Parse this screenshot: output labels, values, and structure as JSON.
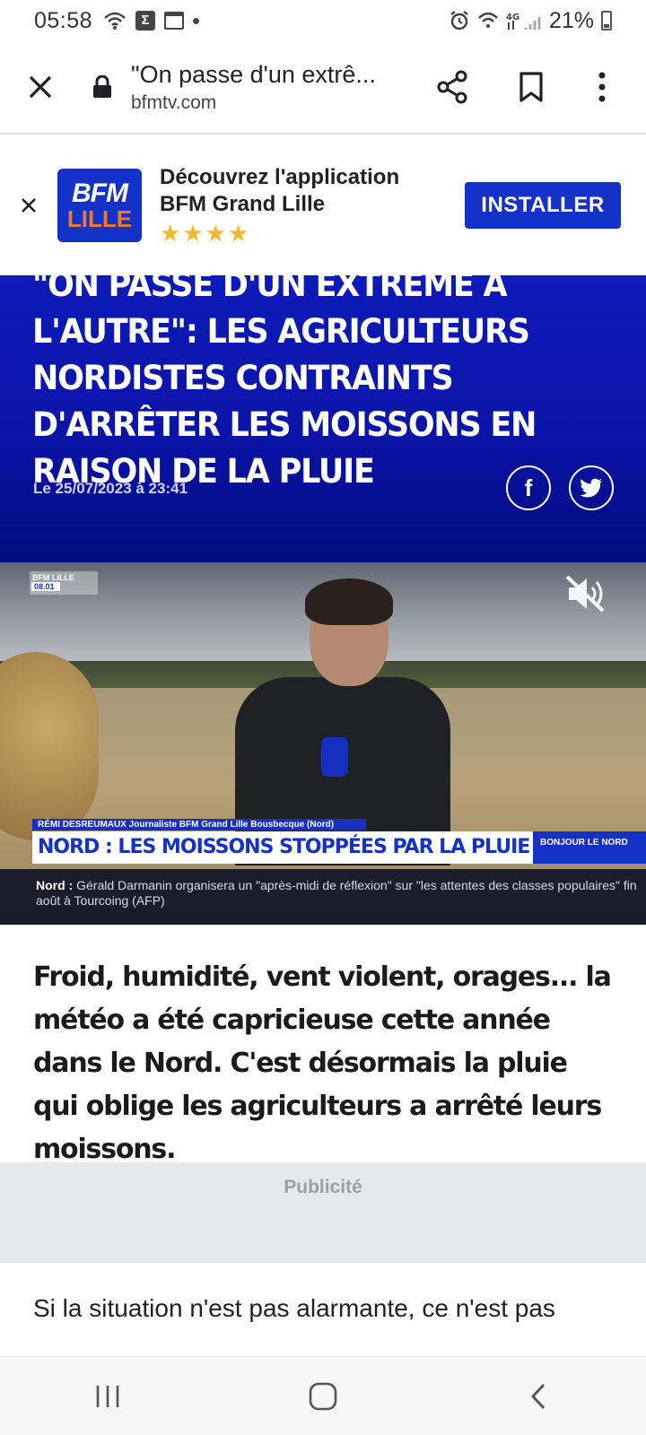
{
  "status_bar": {
    "time": "05:58",
    "battery": "21%",
    "icons": [
      "wifi-icon",
      "sigma-icon",
      "calendar-icon",
      "dot-icon",
      "alarm-icon",
      "wifi-4g-icon",
      "signal-icon",
      "battery-icon"
    ]
  },
  "toolbar": {
    "page_title": "\"On passe d'un extrê...",
    "domain": "bfmtv.com",
    "icons": [
      "close-icon",
      "lock-icon",
      "share-icon",
      "bookmark-icon",
      "more-vert-icon"
    ]
  },
  "app_banner": {
    "logo_top": "BFM",
    "logo_bottom": "LILLE",
    "line1": "Découvrez l'application",
    "line2": "BFM Grand Lille",
    "stars": "★★★★",
    "install_label": "INSTALLER",
    "accent": "#1432c8"
  },
  "article": {
    "title": "\"On passe d'un extrême à l'autre\": les agriculteurs nordistes contraints d'arrêter les moissons en raison de la pluie",
    "date": "Le 25/07/2023 à 23:41",
    "share": {
      "facebook": "f"
    },
    "lead": "Froid, humidité, vent violent, orages... la météo a été capricieuse cette année dans le Nord. C'est désormais la pluie qui oblige les agriculteurs a arrêté leurs moissons.",
    "body_first_line": "Si la situation n'est pas alarmante, ce n'est pas"
  },
  "video": {
    "bug_top": "BFM LILLE",
    "bug_time": "08.01",
    "name_bar": "RÉMI DESREUMAUX  Journaliste BFM Grand Lille  Bousbecque (Nord)",
    "headline": "NORD : LES MOISSONS STOPPÉES PAR LA PLUIE",
    "show_name": "BONJOUR LE NORD",
    "ticker_label": "Nord :",
    "ticker_text": "Gérald Darmanin organisera un \"après-midi de réflexion\" sur \"les attentes des classes populaires\" fin août à Tourcoing (AFP)"
  },
  "ad": {
    "label": "Publicité"
  },
  "hero_color": "#0e1bb8"
}
